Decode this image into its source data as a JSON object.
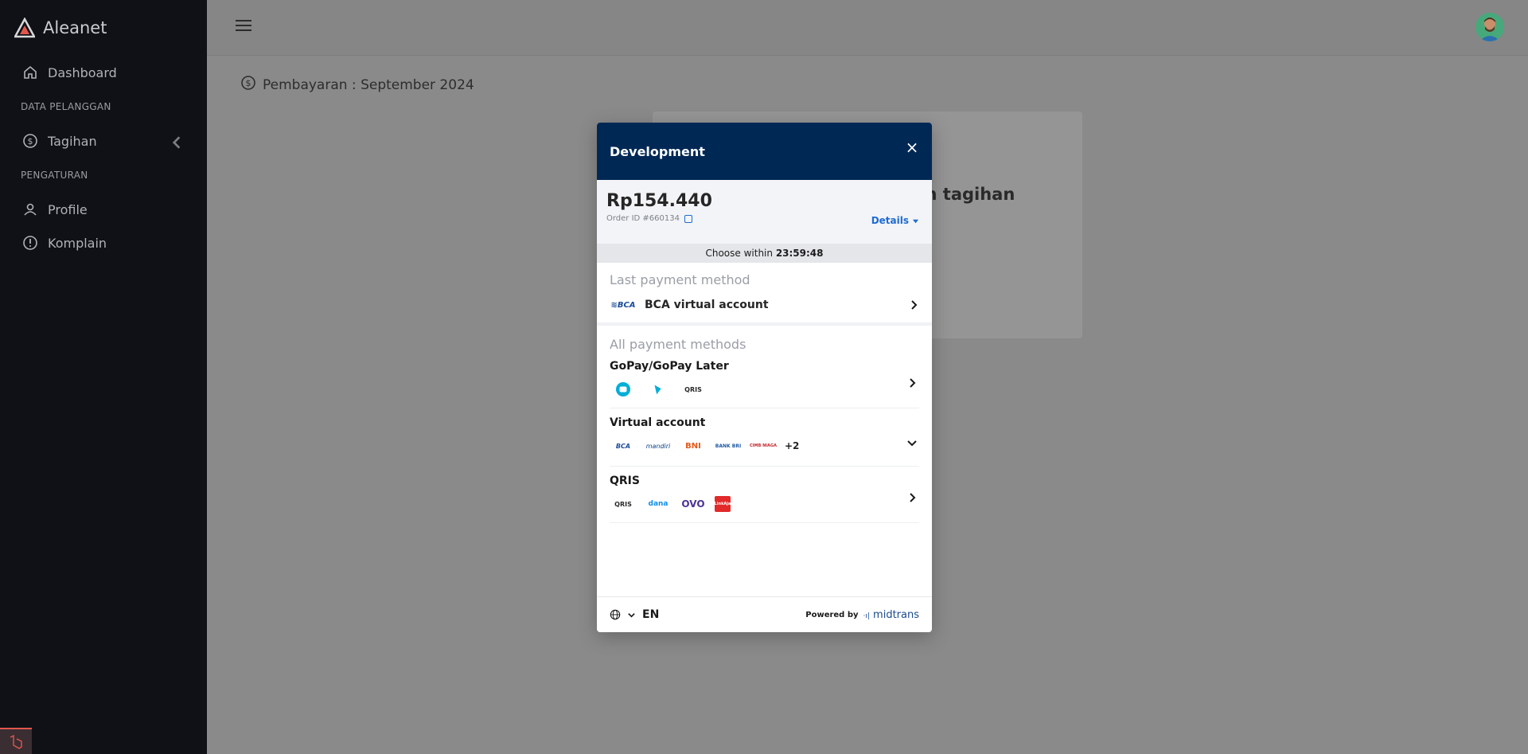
{
  "app": {
    "name": "Aleanet"
  },
  "sidebar": {
    "items": [
      {
        "label": "Dashboard",
        "icon": "home-icon"
      },
      {
        "section": "DATA PELANGGAN"
      },
      {
        "label": "Tagihan",
        "icon": "dollar-icon"
      },
      {
        "section": "PENGATURAN"
      },
      {
        "label": "Profile",
        "icon": "user-icon"
      },
      {
        "label": "Komplain",
        "icon": "alert-icon"
      }
    ]
  },
  "page": {
    "title": "Pembayaran : September 2024",
    "card_title": "ran tagihan"
  },
  "modal": {
    "title": "Development",
    "close": "×",
    "amount": "Rp154.440",
    "order_id": "Order ID #660134",
    "details": "Details",
    "timer_label": "Choose within",
    "timer_value": "23:59:48",
    "last_label": "Last payment method",
    "last_method": "BCA virtual account",
    "all_label": "All payment methods",
    "methods": [
      {
        "title": "GoPay/GoPay Later",
        "logos": [
          "gopay-logo",
          "gopay-later-logo",
          "qris-logo"
        ]
      },
      {
        "title": "Virtual account",
        "logos": [
          "BCA",
          "mandiri",
          "BNI",
          "BANK BRI",
          "CIMB NIAGA"
        ],
        "more": "+2"
      },
      {
        "title": "QRIS",
        "logos": [
          "QRIS",
          "dana",
          "OVO",
          "LinkAja"
        ]
      }
    ],
    "footer": {
      "lang": "EN",
      "powered": "Powered by",
      "brand": "midtrans"
    }
  },
  "colors": {
    "modal_header": "#002855",
    "accent": "#1f6bd1",
    "sidebar": "#0f1117"
  }
}
